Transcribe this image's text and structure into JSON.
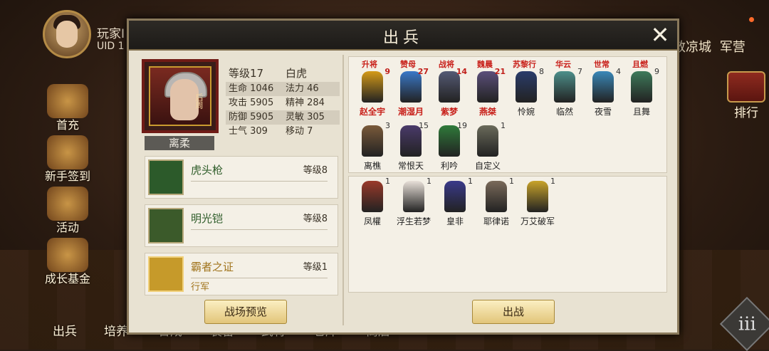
{
  "player": {
    "name": "玩家I",
    "uid": "UID 1"
  },
  "left_menu": [
    {
      "label": "首充",
      "icon": "first-charge-icon"
    },
    {
      "label": "新手签到",
      "icon": "signin-icon"
    },
    {
      "label": "活动",
      "icon": "event-icon"
    },
    {
      "label": "成长基金",
      "icon": "growth-fund-icon"
    }
  ],
  "top_right": {
    "city": "敦凉城",
    "camp": "军营",
    "rank_label": "排行"
  },
  "bottom_nav": [
    "出兵",
    "培养",
    "合成",
    "装备",
    "武将",
    "仓库",
    "商店"
  ],
  "dialog": {
    "title": "出兵",
    "hero": {
      "name": "离柔",
      "portrait_tag": "后周",
      "level_label": "等级17",
      "beast": "白虎",
      "stats": [
        [
          "生命 1046",
          "法力 46"
        ],
        [
          "攻击 5905",
          "精神 284"
        ],
        [
          "防御 5905",
          "灵敏 305"
        ],
        [
          "士气 309",
          "移动 7"
        ]
      ]
    },
    "equipment": [
      {
        "name": "虎头枪",
        "level": "等级8",
        "sub": "",
        "icon": "spear-icon"
      },
      {
        "name": "明光铠",
        "level": "等级8",
        "sub": "",
        "icon": "armor-icon"
      },
      {
        "name": "霸者之证",
        "level": "等级1",
        "sub": "行军",
        "icon": "badge-icon"
      }
    ],
    "preview_button": "战场预览",
    "deploy_button": "出战",
    "top_cut_names": [
      "升将",
      "赞母",
      "战将",
      "魏晨",
      "苏黎行",
      "华云",
      "世常",
      "且燃"
    ],
    "units_row1": [
      {
        "name": "赵全宇",
        "count": "9",
        "red": true,
        "color": "#d49a18"
      },
      {
        "name": "潮湿月",
        "count": "27",
        "red": true,
        "color": "#3a78c8"
      },
      {
        "name": "紫梦",
        "count": "14",
        "red": true,
        "color": "#555a74"
      },
      {
        "name": "燕桀",
        "count": "21",
        "red": true,
        "color": "#5b4f7a"
      },
      {
        "name": "怜婉",
        "count": "8",
        "red": false,
        "color": "#2a3c6a"
      },
      {
        "name": "临然",
        "count": "7",
        "red": false,
        "color": "#4d8f8a"
      },
      {
        "name": "夜雪",
        "count": "4",
        "red": false,
        "color": "#3a88b8"
      },
      {
        "name": "且舞",
        "count": "9",
        "red": false,
        "color": "#3e7a5a"
      }
    ],
    "units_row2": [
      {
        "name": "离樵",
        "count": "3",
        "red": false,
        "color": "#7a5a3a"
      },
      {
        "name": "常恨天",
        "count": "15",
        "red": false,
        "color": "#4a3a6a"
      },
      {
        "name": "利吟",
        "count": "19",
        "red": false,
        "color": "#2f7a3a"
      },
      {
        "name": "自定义",
        "count": "1",
        "red": false,
        "color": "#6a6a5a"
      }
    ],
    "units_row3": [
      {
        "name": "凤權",
        "count": "1",
        "red": false,
        "color": "#9a3a2a"
      },
      {
        "name": "浮生若梦",
        "count": "1",
        "red": false,
        "color": "#e8e0d8"
      },
      {
        "name": "皇非",
        "count": "1",
        "red": false,
        "color": "#3a3a8a"
      },
      {
        "name": "耶律诺",
        "count": "1",
        "red": false,
        "color": "#7a6a5a"
      },
      {
        "name": "万艾破军",
        "count": "1",
        "red": false,
        "color": "#c8a32a"
      }
    ]
  }
}
